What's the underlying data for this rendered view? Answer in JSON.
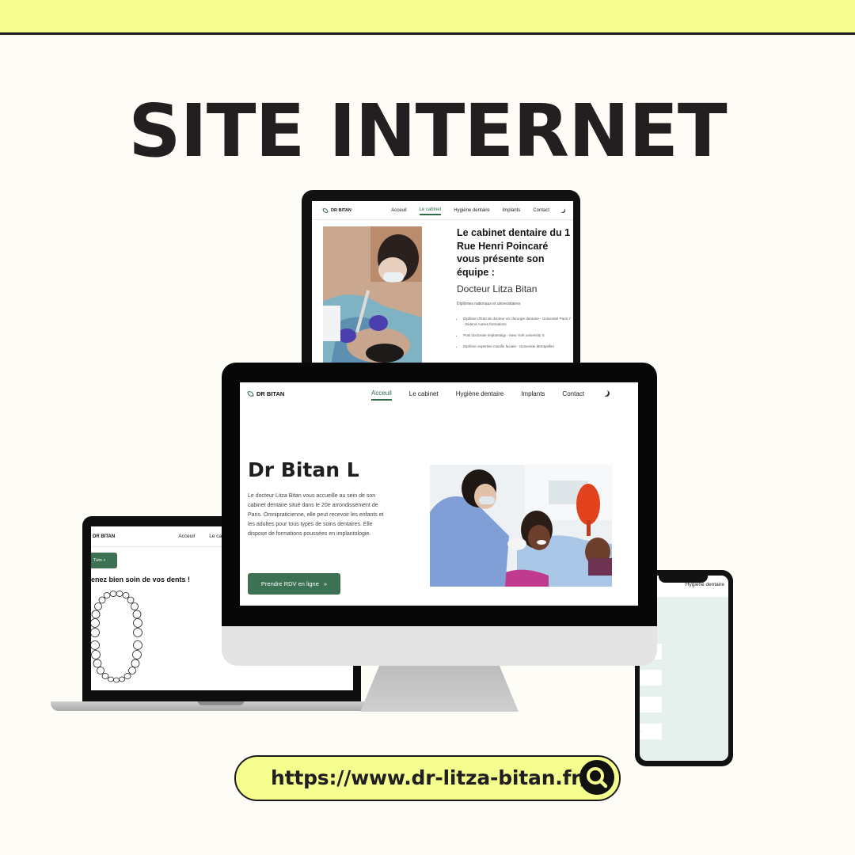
{
  "headline": "SITE INTERNET",
  "brand": {
    "logo_text": "DR BITAN",
    "accent_color": "#3d7154",
    "highlight_color": "#f6fd8f"
  },
  "tablet": {
    "nav": {
      "items": [
        "Acceuil",
        "Le cabinet",
        "Hygiène dentaire",
        "Implants",
        "Contact"
      ],
      "active_index": 1
    },
    "title": "Le cabinet dentaire du 1 Rue Henri Poincaré vous présente son équipe :",
    "doctor_name": "Docteur Litza Bitan",
    "diplomas_heading": "Diplômes nationaux et universitaires",
    "diplomas": [
      "Diplôme d'Etat de docteur en chirurgie dentaire - Université Paris 7 - Diderot Autres formations",
      "Post doctorate implantolgy - New York university S",
      "Diplôme expertise maxillo faciale - Universite Montpellier"
    ]
  },
  "monitor": {
    "nav": {
      "items": [
        "Acceuil",
        "Le cabinet",
        "Hygiène dentaire",
        "Implants",
        "Contact"
      ],
      "active_index": 0
    },
    "hero_title": "Dr Bitan L",
    "hero_body": "Le docteur Litza Bitan vous accueille au sein de son cabinet dentaire situé dans le 20e arrondissement de Paris. Omnipraticienne, elle peut recevoir les enfants et les adultes pour tous types de soins dentaires. Elle dispose de formations poussées en implantologie.",
    "cta_label": "Prendre RDV en ligne",
    "cta_icon": "double-chevron-right-icon"
  },
  "laptop": {
    "nav": {
      "items": [
        "Acceuil",
        "Le cabinet"
      ]
    },
    "tag_label": "Tuto",
    "heading": "enez bien soin de vos dents !"
  },
  "phone": {
    "nav_text": "Hygiène dentaire",
    "field_mark": "."
  },
  "url": "https://www.dr-litza-bitan.fr/",
  "url_icon": "search-icon"
}
